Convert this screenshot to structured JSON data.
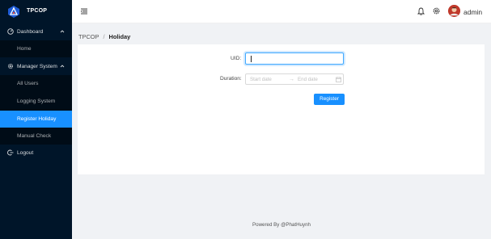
{
  "app": {
    "logo_text": "TPCOP"
  },
  "sidebar": {
    "groups": [
      {
        "label": "Dashboard",
        "icon": "dashboard-icon",
        "items": [
          {
            "label": "Home"
          }
        ]
      },
      {
        "label": "Manager System",
        "icon": "gear-icon",
        "items": [
          {
            "label": "All Users"
          },
          {
            "label": "Logging System"
          },
          {
            "label": "Register Holiday",
            "active": true
          },
          {
            "label": "Manual Check"
          }
        ]
      }
    ],
    "logout": {
      "label": "Logout",
      "icon": "logout-icon"
    }
  },
  "header": {
    "user_name": "admin",
    "icons": [
      "menu-icon",
      "bell-icon",
      "gear-icon"
    ]
  },
  "breadcrumb": {
    "root": "TPCOP",
    "separator": "/",
    "current": "Holiday"
  },
  "form": {
    "uid_label": "UID:",
    "uid_value": "",
    "duration_label": "Duration:",
    "start_placeholder": "Start date",
    "end_placeholder": "End date",
    "arrow": "→",
    "submit_label": "Register"
  },
  "footer": {
    "text": "Powered By @PhatHuynh"
  },
  "colors": {
    "sidebar_bg": "#001529",
    "accent": "#1890ff",
    "page_bg": "#f0f2f5"
  }
}
